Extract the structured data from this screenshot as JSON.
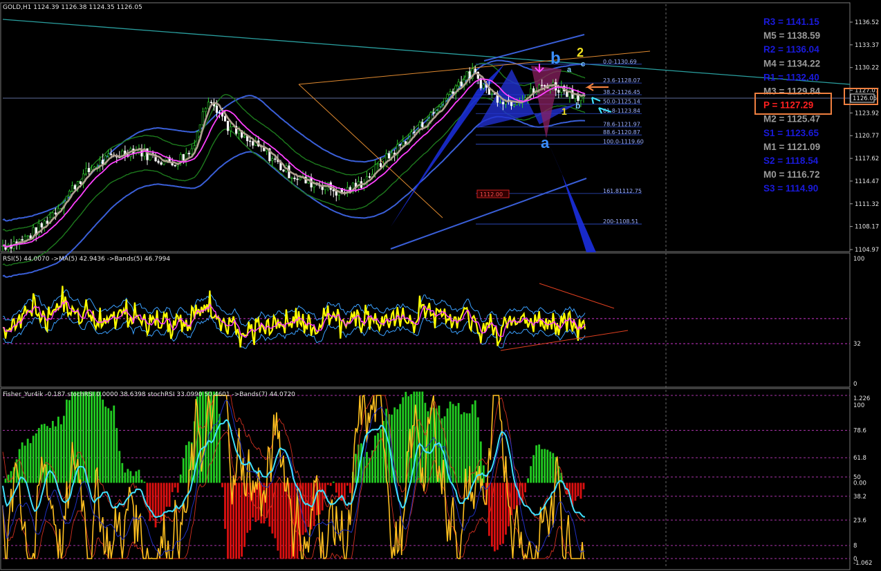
{
  "main": {
    "title": "GOLD,H1  1124.39 1126.38 1124.35 1126.05",
    "price_ticks": [
      "1136.52",
      "1133.37",
      "1130.22",
      "1127.07",
      "1123.92",
      "1120.77",
      "1117.62",
      "1114.47",
      "1111.32",
      "1108.17",
      "1104.97"
    ],
    "last_price": "1126.05",
    "box_label": "1112.00"
  },
  "fib_levels": [
    {
      "label": "0.0-1130.69",
      "value": 1130.69
    },
    {
      "label": "23.6-1128.07",
      "value": 1128.07
    },
    {
      "label": "38.2-1126.45",
      "value": 1126.45
    },
    {
      "label": "50.0-1125.14",
      "value": 1125.14
    },
    {
      "label": "61.8-1123.84",
      "value": 1123.84
    },
    {
      "label": "78.6-1121.97",
      "value": 1121.97
    },
    {
      "label": "88.6-1120.87",
      "value": 1120.87
    },
    {
      "label": "100.0-1119.60",
      "value": 1119.6
    },
    {
      "label": "161.81112.75",
      "value": 1112.75
    },
    {
      "label": "200-1108.51",
      "value": 1108.51
    }
  ],
  "pivots": [
    {
      "label": "R3 = 1141.15",
      "color": "#1a1adc"
    },
    {
      "label": "M5 = 1138.59",
      "color": "#9a9a9a"
    },
    {
      "label": "R2 = 1136.04",
      "color": "#1a1adc"
    },
    {
      "label": "M4 = 1134.22",
      "color": "#9a9a9a"
    },
    {
      "label": "R1 = 1132.40",
      "color": "#1a1adc"
    },
    {
      "label": "M3 = 1129.84",
      "color": "#9a9a9a"
    },
    {
      "label": "P  = 1127.29",
      "color": "#ff2020"
    },
    {
      "label": "M2 = 1125.47",
      "color": "#9a9a9a"
    },
    {
      "label": "S1 = 1123.65",
      "color": "#1a1adc"
    },
    {
      "label": "M1 = 1121.09",
      "color": "#9a9a9a"
    },
    {
      "label": "S2 = 1118.54",
      "color": "#1a1adc"
    },
    {
      "label": "M0 = 1116.72",
      "color": "#9a9a9a"
    },
    {
      "label": "S3 = 1114.90",
      "color": "#1a1adc"
    }
  ],
  "waves": [
    {
      "label": "b",
      "color": "#3b8fff"
    },
    {
      "label": "2",
      "color": "#f0e020"
    },
    {
      "label": "a",
      "color": "#7fd0ff"
    },
    {
      "label": "c",
      "color": "#7fd0ff"
    },
    {
      "label": "b",
      "color": "#7fd0ff"
    },
    {
      "label": "1",
      "color": "#f0e020"
    },
    {
      "label": "a",
      "color": "#3b8fff"
    }
  ],
  "rsi": {
    "title": "RSI(5) 44.0070  ->MA(5) 42.9436  ->Bands(5) 46.7994",
    "ticks": [
      "100",
      "32",
      "0"
    ]
  },
  "fisher": {
    "title": "Fisher_Yur4ik -0.187  stochRSI 0.0000 38.6398  stochRSI 33.0990 50.4601  ->Bands(7) 44.0720",
    "ticks": [
      "1.226",
      "100",
      "78.6",
      "61.8",
      "50",
      "0.00",
      "38.2",
      "23.6",
      "8",
      "0",
      "-1.062"
    ]
  },
  "colors": {
    "bull_candle": "#ffffff",
    "bear_candle": "#ffffff",
    "bollinger": "#3a5fd8",
    "inner_band": "#1d7a1d",
    "ma": "#ff40ff",
    "rsi": "#ffff00",
    "histo_up": "#22cc22",
    "histo_down": "#dd1010",
    "stoch": "#ffc020",
    "fisher_line": "#40e0ff"
  },
  "chart_data": [
    {
      "type": "candlestick",
      "title": "GOLD,H1",
      "series": [
        {
          "name": "GOLD,H1",
          "values_close_approx": [
            1105.5,
            1106.2,
            1108.0,
            1111.0,
            1114.5,
            1116.8,
            1118.0,
            1119.0,
            1117.8,
            1117.0,
            1118.5,
            1126.5,
            1122.0,
            1120.0,
            1118.5,
            1116.0,
            1114.5,
            1114.0,
            1112.8,
            1114.0,
            1116.5,
            1119.0,
            1121.5,
            1124.0,
            1127.5,
            1129.5,
            1126.5,
            1125.5,
            1126.5,
            1128.0,
            1127.0,
            1126.05
          ]
        }
      ],
      "ylim": [
        1104.97,
        1136.52
      ],
      "last": 1126.05
    },
    {
      "type": "line",
      "title": "RSI(5) 44.0070  ->MA(5) 42.9436  ->Bands(5) 46.7994",
      "ylim": [
        0,
        100
      ],
      "levels": [
        32
      ]
    },
    {
      "type": "bar",
      "title": "Fisher_Yur4ik -0.187",
      "ylim": [
        -1.062,
        1.226
      ]
    }
  ]
}
